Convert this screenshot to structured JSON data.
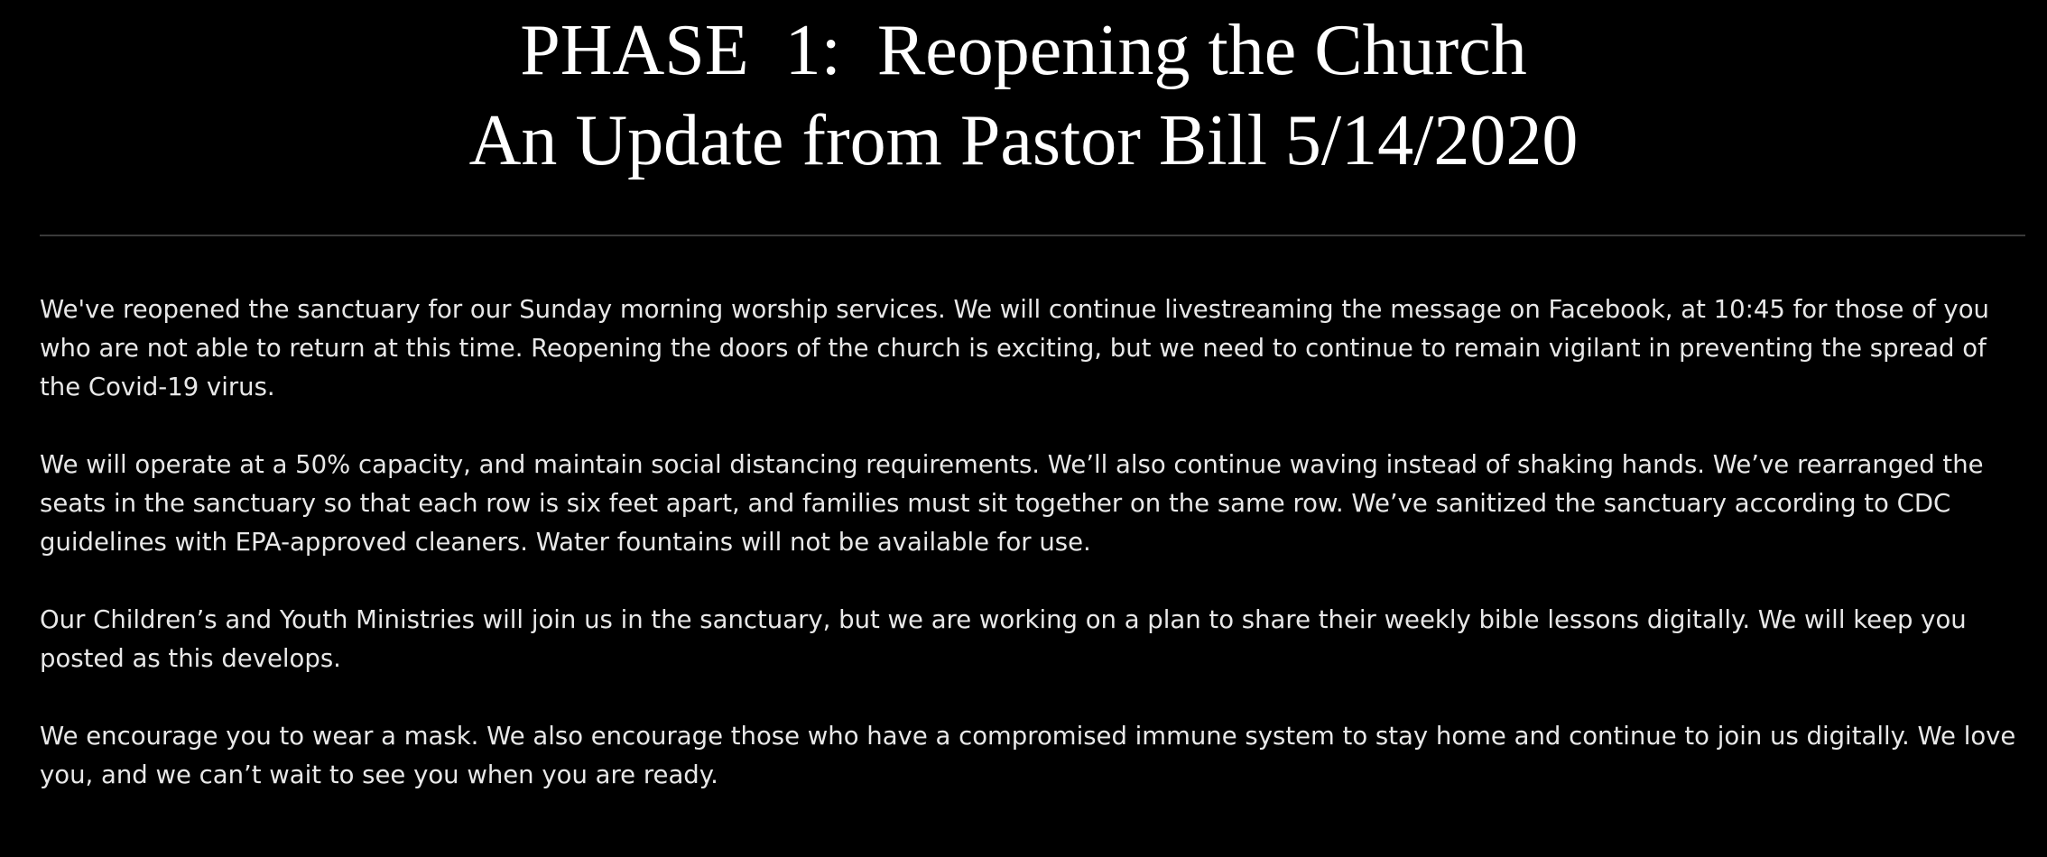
{
  "header": {
    "title_line1": "PHASE  1:  Reopening the Church",
    "title_line2": "An Update from Pastor Bill 5/14/2020"
  },
  "paragraphs": [
    "We've reopened the sanctuary for our Sunday morning worship services. We will continue livestreaming the message on Facebook, at 10:45 for those of you who are not able to return at this time. Reopening the doors of the church is exciting, but we need to continue to remain vigilant in preventing the spread of the Covid-19 virus.",
    "We will operate at a 50% capacity, and maintain social distancing requirements. We’ll also continue waving instead of shaking hands. We’ve rearranged the seats in the sanctuary so that each row is six feet apart, and families must sit together on the same row. We’ve sanitized the sanctuary according to CDC guidelines with EPA-approved cleaners. Water fountains will not be available for use.",
    "Our Children’s and Youth Ministries will join us in the sanctuary, but we are working on a plan to share their weekly bible lessons digitally. We will keep you posted as this develops.",
    "We encourage you to wear a mask. We also encourage those who have a compromised immune system to stay home and continue to join us digitally. We love you, and we can’t wait to see you when you are ready."
  ],
  "colors": {
    "background": "#000000",
    "title_text": "#ffffff",
    "body_text": "#e8e8e8",
    "divider": "#3a3a3a"
  }
}
